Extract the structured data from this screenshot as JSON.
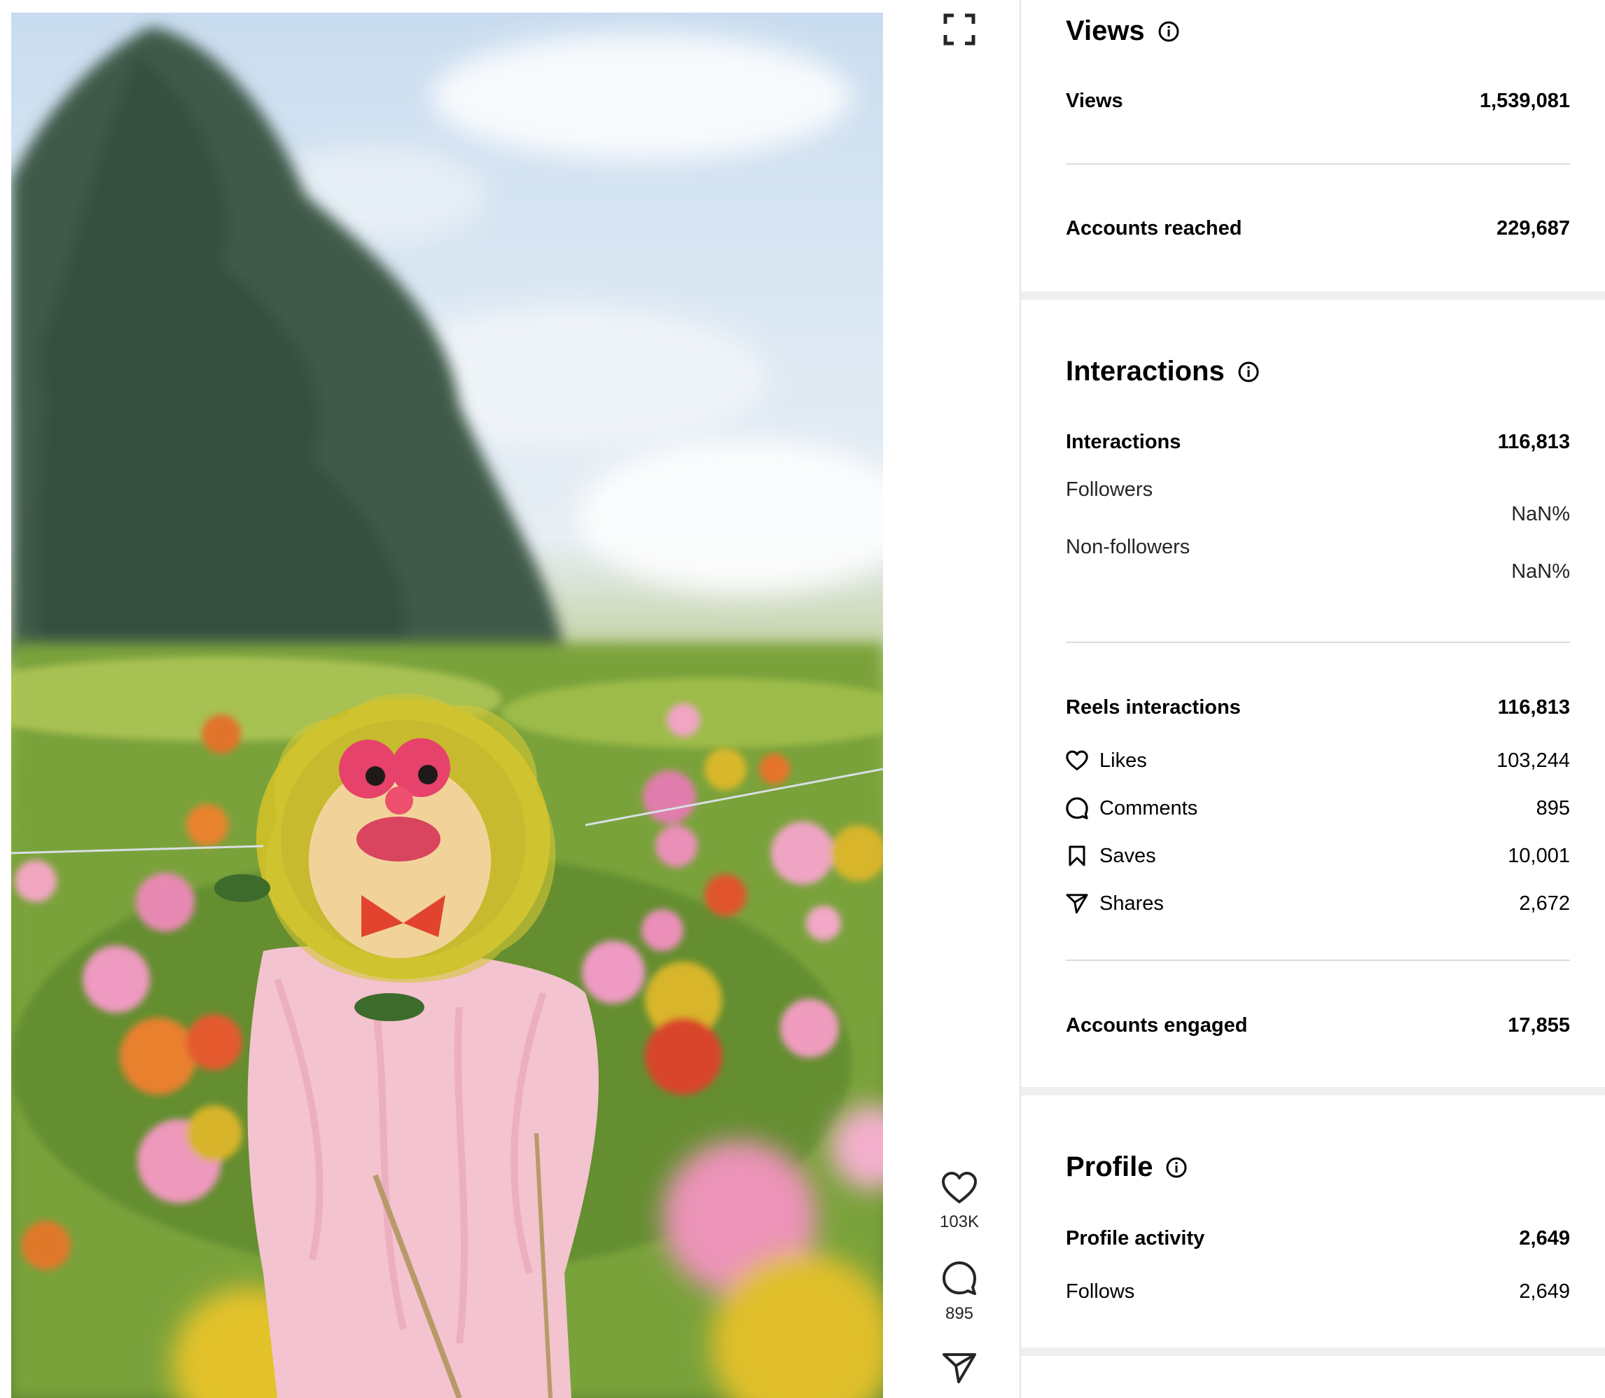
{
  "post": {
    "likes_count": "103K",
    "comments_count": "895"
  },
  "views": {
    "title": "Views",
    "views_label": "Views",
    "views_value": "1,539,081",
    "reached_label": "Accounts reached",
    "reached_value": "229,687"
  },
  "interactions": {
    "title": "Interactions",
    "total_label": "Interactions",
    "total_value": "116,813",
    "followers_label": "Followers",
    "followers_value": "NaN%",
    "nonfollowers_label": "Non-followers",
    "nonfollowers_value": "NaN%",
    "reels_label": "Reels interactions",
    "reels_value": "116,813",
    "breakdown": [
      {
        "icon": "heart-icon",
        "label": "Likes",
        "value": "103,244"
      },
      {
        "icon": "comment-icon",
        "label": "Comments",
        "value": "895"
      },
      {
        "icon": "bookmark-icon",
        "label": "Saves",
        "value": "10,001"
      },
      {
        "icon": "share-icon",
        "label": "Shares",
        "value": "2,672"
      }
    ],
    "engaged_label": "Accounts engaged",
    "engaged_value": "17,855"
  },
  "profile": {
    "title": "Profile",
    "activity_label": "Profile activity",
    "activity_value": "2,649",
    "follows_label": "Follows",
    "follows_value": "2,649"
  },
  "colors": {
    "divider": "#dbdbdb",
    "band": "#efefef",
    "text": "#000000"
  }
}
